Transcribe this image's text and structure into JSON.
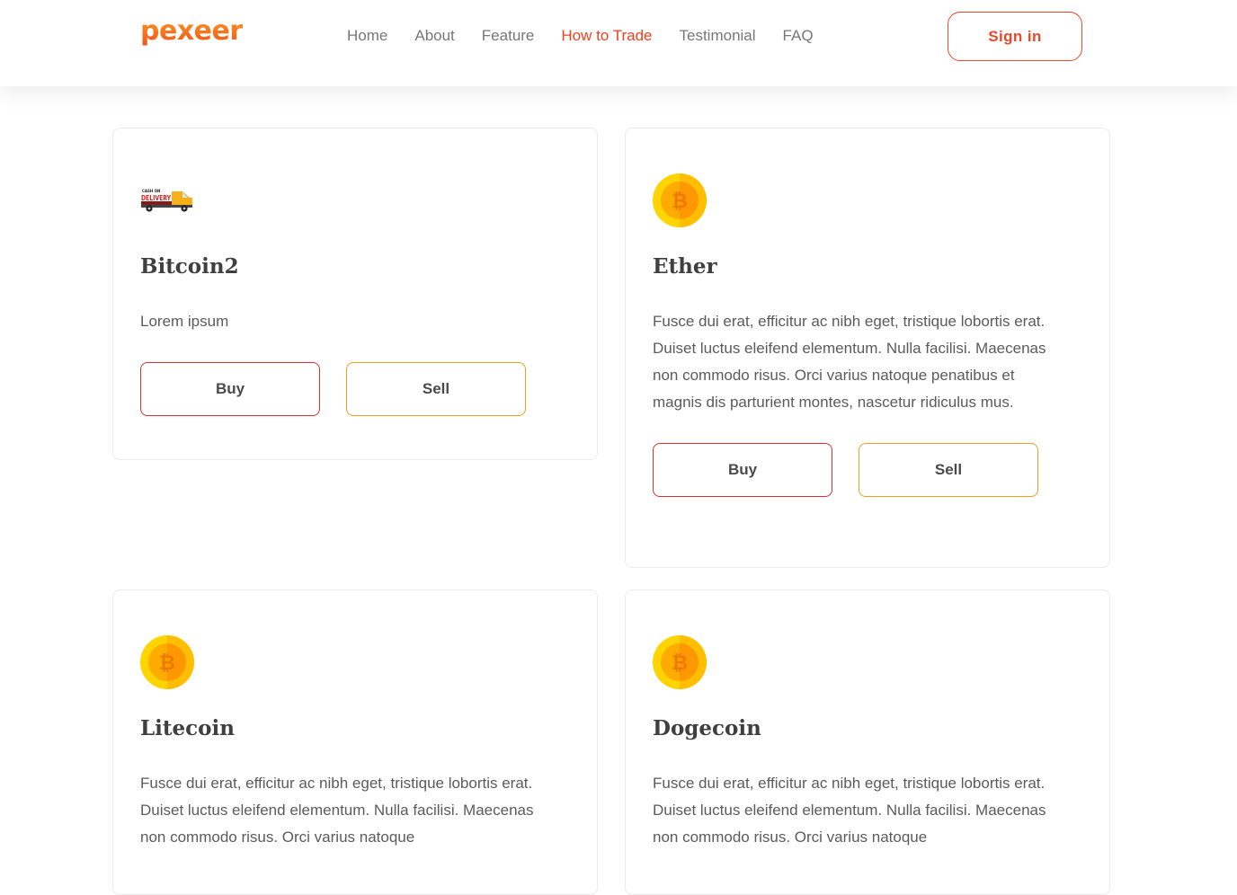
{
  "brand": {
    "logo_text": "pexeer",
    "accent": "#f0421e",
    "logo_gradient": [
      "#ff9a1f",
      "#f0521c"
    ]
  },
  "nav": {
    "items": [
      {
        "label": "Home",
        "active": false
      },
      {
        "label": "About",
        "active": false
      },
      {
        "label": "Feature",
        "active": false
      },
      {
        "label": "How to Trade",
        "active": true
      },
      {
        "label": "Testimonial",
        "active": false
      },
      {
        "label": "FAQ",
        "active": false
      }
    ],
    "signin_label": "Sign in"
  },
  "cards": [
    {
      "icon": "delivery-truck-icon",
      "icon_text": "DELIVERY",
      "title": "Bitcoin2",
      "text": "Lorem ipsum",
      "buy_label": "Buy",
      "sell_label": "Sell"
    },
    {
      "icon": "bitcoin-coin-icon",
      "title": "Ether",
      "text": "Fusce dui erat, efficitur ac nibh eget, tristique lobortis erat. Duiset luctus eleifend elementum. Nulla facilisi. Maecenas non commodo risus. Orci varius natoque penatibus et magnis dis parturient montes, nascetur ridiculus mus.",
      "buy_label": "Buy",
      "sell_label": "Sell"
    },
    {
      "icon": "bitcoin-coin-icon",
      "title": "Litecoin",
      "text": "Fusce dui erat, efficitur ac nibh eget, tristique lobortis erat. Duiset luctus eleifend elementum. Nulla facilisi. Maecenas non commodo risus. Orci varius natoque"
    },
    {
      "icon": "bitcoin-coin-icon",
      "title": "Dogecoin",
      "text": "Fusce dui erat, efficitur ac nibh eget, tristique lobortis erat. Duiset luctus eleifend elementum. Nulla facilisi. Maecenas non commodo risus. Orci varius natoque"
    }
  ],
  "colors": {
    "buy_border": "#d9322a",
    "sell_border": "#f0a020",
    "coin_outer": "#ffd400",
    "coin_inner": "#ffab00"
  }
}
